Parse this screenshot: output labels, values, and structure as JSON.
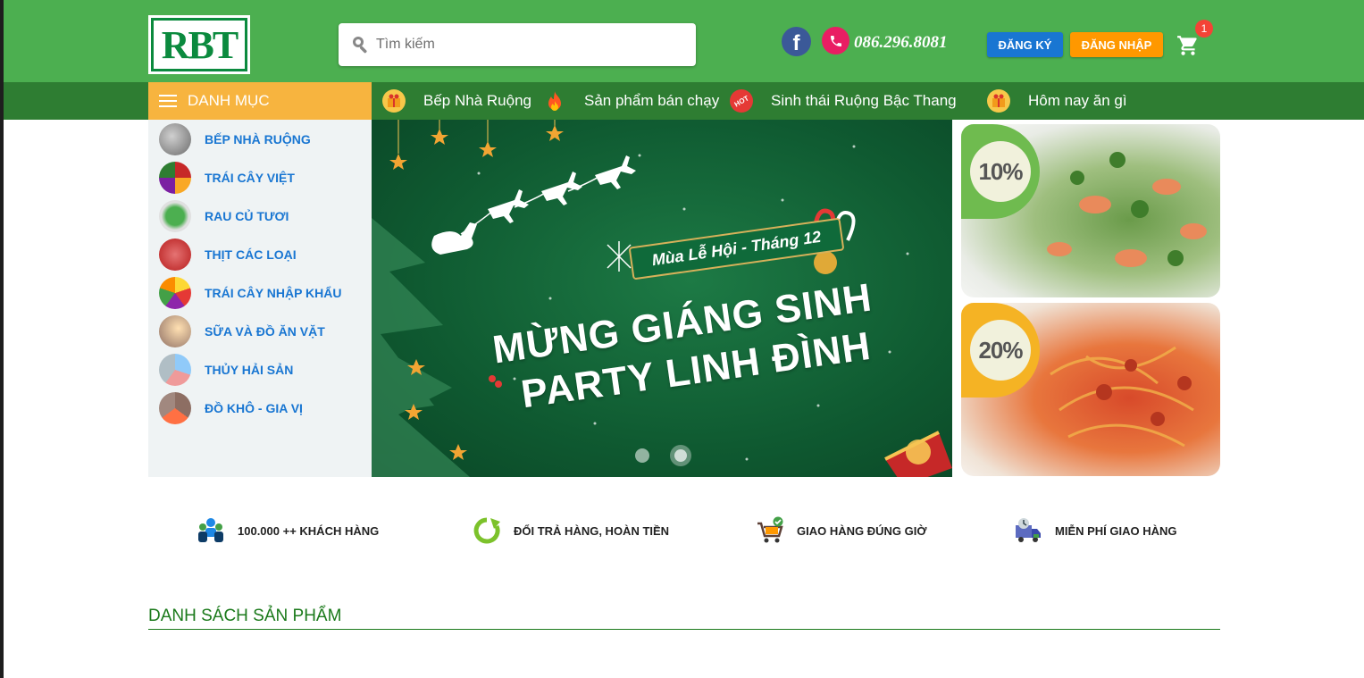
{
  "brand": {
    "logo_text": "RBT"
  },
  "search": {
    "placeholder": "Tìm kiếm"
  },
  "contact": {
    "phone": "086.296.8081"
  },
  "auth": {
    "register_label": "ĐĂNG KÝ",
    "login_label": "ĐĂNG NHẬP"
  },
  "cart": {
    "count": "1"
  },
  "nav": {
    "category_label": "DANH MỤC",
    "items": [
      {
        "label": "Bếp Nhà Ruộng",
        "icon": "gift-box-icon"
      },
      {
        "label": "Sản phẩm bán chạy",
        "icon": "fire-icon"
      },
      {
        "label": "Sinh thái Ruộng Bậc Thang",
        "icon": "hot-badge-icon"
      },
      {
        "label": "Hôm nay ăn gì",
        "icon": "gift-box-icon"
      }
    ]
  },
  "categories": [
    {
      "label": "BẾP NHÀ RUỘNG"
    },
    {
      "label": "TRÁI CÂY VIỆT"
    },
    {
      "label": "RAU CỦ TƯƠI"
    },
    {
      "label": "THỊT CÁC LOẠI"
    },
    {
      "label": "TRÁI CÂY NHẬP KHẨU"
    },
    {
      "label": "SỮA VÀ ĐỒ ĂN VẶT"
    },
    {
      "label": "THỦY HẢI SẢN"
    },
    {
      "label": "ĐỒ KHÔ - GIA VỊ"
    }
  ],
  "banner": {
    "subtitle": "Mùa Lễ Hội - Tháng 12",
    "line1": "MỪNG GIÁNG SINH",
    "line2": "PARTY LINH ĐÌNH",
    "slide_count": 2,
    "active_slide": 2
  },
  "promos": [
    {
      "discount": "10%"
    },
    {
      "discount": "20%"
    }
  ],
  "features": [
    {
      "label": "100.000 ++ KHÁCH HÀNG",
      "icon": "customers-icon"
    },
    {
      "label": "ĐỔI TRẢ HÀNG, HOÀN TIỀN",
      "icon": "refresh-icon"
    },
    {
      "label": "GIAO HÀNG ĐÚNG GIỜ",
      "icon": "cart-check-icon"
    },
    {
      "label": "MIỄN PHÍ GIAO HÀNG",
      "icon": "delivery-truck-icon"
    }
  ],
  "section": {
    "title": "DANH SÁCH SẢN PHẨM"
  },
  "colors": {
    "primary_green": "#4caf50",
    "dark_green": "#2e7d32",
    "category_orange": "#f7b43f",
    "register_blue": "#1976d2",
    "login_orange": "#ff9800",
    "link_blue": "#1976d2"
  }
}
